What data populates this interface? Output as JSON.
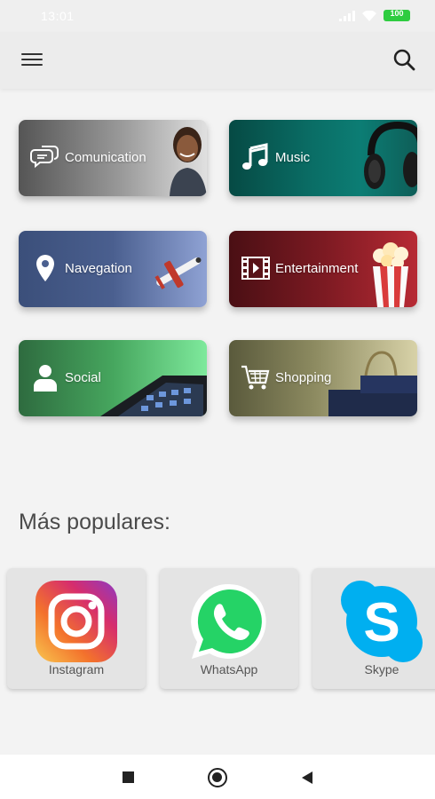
{
  "status_bar": {
    "time": "13:01",
    "battery": "100"
  },
  "app_bar": {
    "menu_icon": "hamburger-icon",
    "search_icon": "search-icon"
  },
  "categories": [
    {
      "label": "Comunication",
      "icon": "chat-bubbles-icon"
    },
    {
      "label": "Music",
      "icon": "music-note-icon"
    },
    {
      "label": "Navegation",
      "icon": "map-pin-icon"
    },
    {
      "label": "Entertainment",
      "icon": "film-icon"
    },
    {
      "label": "Social",
      "icon": "person-icon"
    },
    {
      "label": "Shopping",
      "icon": "shopping-cart-icon"
    }
  ],
  "popular": {
    "title": "Más populares:",
    "apps": [
      {
        "name": "Instagram",
        "icon": "instagram-logo-icon"
      },
      {
        "name": "WhatsApp",
        "icon": "whatsapp-logo-icon"
      },
      {
        "name": "Skype",
        "icon": "skype-logo-icon"
      }
    ]
  },
  "nav_bar": {
    "recent": "square-icon",
    "home": "circle-icon",
    "back": "triangle-back-icon"
  },
  "colors": {
    "instagram_gradient": [
      "#f9c74f",
      "#f3722c",
      "#d62d6d",
      "#8e3ac2"
    ],
    "whatsapp": "#25d366",
    "skype": "#00aff0"
  }
}
